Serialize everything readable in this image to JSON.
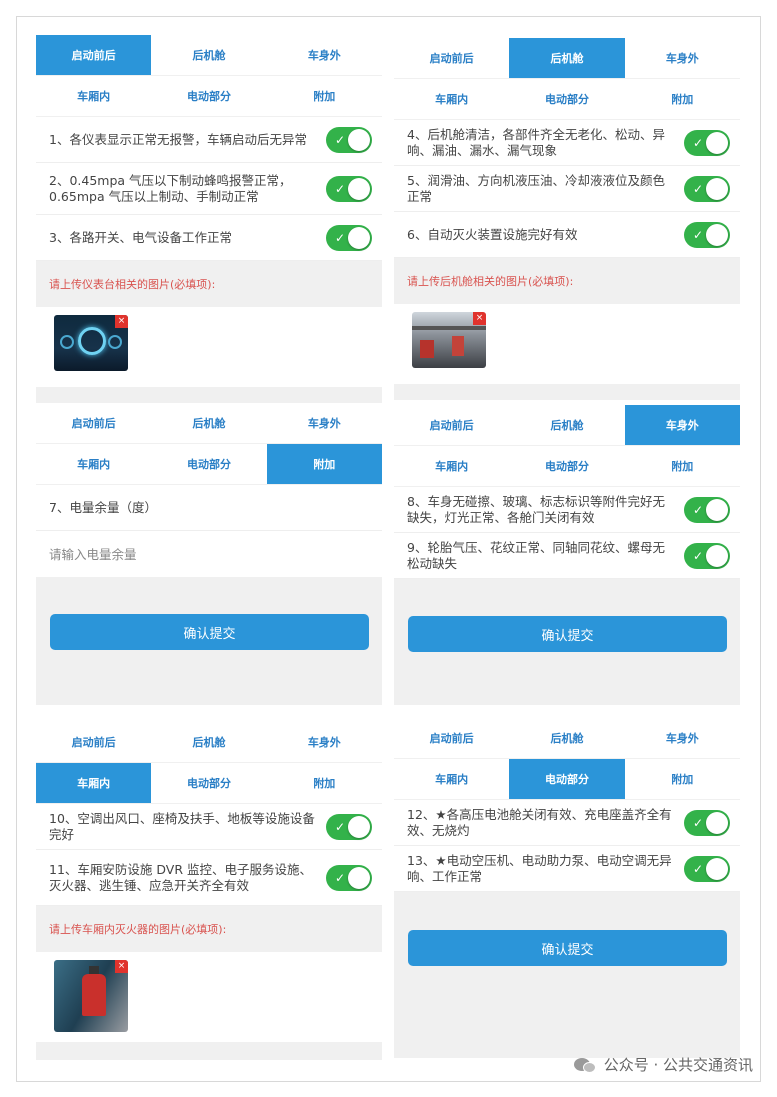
{
  "tabs_row1": [
    "启动前后",
    "后机舱",
    "车身外"
  ],
  "tabs_row2": [
    "车厢内",
    "电动部分",
    "附加"
  ],
  "panel1": {
    "items": [
      "1、各仪表显示正常无报警，车辆启动后无异常",
      "2、0.45mpa 气压以下制动蜂鸣报警正常，0.65mpa 气压以上制动、手制动正常",
      "3、各路开关、电气设备工作正常"
    ],
    "upload_label": "请上传仪表台相关的图片(必填项):"
  },
  "panel2": {
    "items": [
      "4、后机舱清洁，各部件齐全无老化、松动、异响、漏油、漏水、漏气现象",
      "5、润滑油、方向机液压油、冷却液液位及颜色正常",
      "6、自动灭火装置设施完好有效"
    ],
    "upload_label": "请上传后机舱相关的图片(必填项):"
  },
  "panel3": {
    "item": "7、电量余量（度）",
    "input_placeholder": "请输入电量余量",
    "submit_label": "确认提交"
  },
  "panel4": {
    "items": [
      "8、车身无碰擦、玻璃、标志标识等附件完好无缺失，灯光正常、各舱门关闭有效",
      "9、轮胎气压、花纹正常、同轴同花纹、螺母无松动缺失"
    ],
    "submit_label": "确认提交"
  },
  "panel5": {
    "items": [
      "10、空调出风口、座椅及扶手、地板等设施设备完好",
      "11、车厢安防设施 DVR 监控、电子服务设施、灭火器、逃生锤、应急开关齐全有效"
    ],
    "upload_label": "请上传车厢内灭火器的图片(必填项):"
  },
  "panel6": {
    "items": [
      "12、★各高压电池舱关闭有效、充电座盖齐全有效、无烧灼",
      "13、★电动空压机、电动助力泵、电动空调无异响、工作正常"
    ],
    "submit_label": "确认提交"
  },
  "delete_glyph": "×",
  "check_glyph": "✓",
  "watermark": "公众号 · 公共交通资讯",
  "colors": {
    "accent": "#2b95d9",
    "toggle_on": "#33b24a",
    "required_label": "#d9534f"
  },
  "icons": [
    "check-icon",
    "delete-icon",
    "wechat-icon"
  ]
}
